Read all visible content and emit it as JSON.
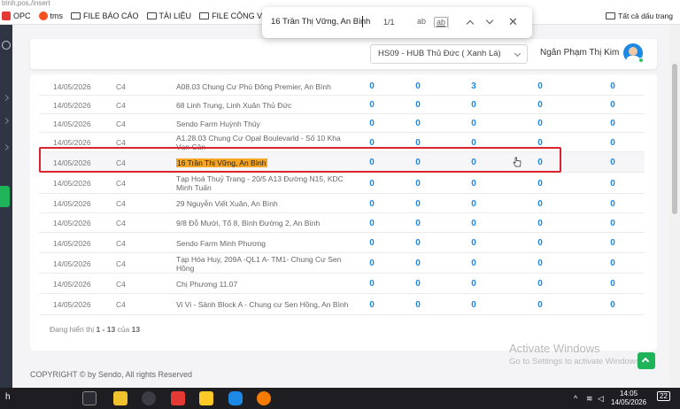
{
  "browser": {
    "address_text": "trinh,pos,/insert",
    "bookmarks": [
      {
        "label": "OPC",
        "icon": "opc-icon"
      },
      {
        "label": "tms",
        "icon": "tms-icon"
      },
      {
        "label": "FILE BÁO CÁO",
        "icon": "folder-icon"
      },
      {
        "label": "TÀI LIỆU",
        "icon": "folder-icon"
      },
      {
        "label": "FILE CÔNG VIỆC",
        "icon": "folder-icon"
      }
    ],
    "all_bookmarks_label": "Tất cả dấu trang"
  },
  "find_bar": {
    "query": "16 Trần Thị Vững, An Bình",
    "count": "1/1",
    "opt_case": "ab",
    "opt_word": "ab"
  },
  "header": {
    "hub_selected": "HS09 - HUB Thủ Đức ( Xanh Lá)",
    "user_name": "Ngân Phạm Thị Kim"
  },
  "table": {
    "rows": [
      {
        "date": "14/05/2026",
        "type": "C4",
        "address": "A08.03 Chung Cư Phú Đông Premier, An Bình",
        "v1": "0",
        "v2": "0",
        "v3": "3",
        "v4": "0",
        "v5": "0"
      },
      {
        "date": "14/05/2026",
        "type": "C4",
        "address": "68 Linh Trung, Linh Xuân Thủ Đức",
        "v1": "0",
        "v2": "0",
        "v3": "0",
        "v4": "0",
        "v5": "0"
      },
      {
        "date": "14/05/2026",
        "type": "C4",
        "address": "Sendo Farm Huỳnh Thúy",
        "v1": "0",
        "v2": "0",
        "v3": "0",
        "v4": "0",
        "v5": "0"
      },
      {
        "date": "14/05/2026",
        "type": "C4",
        "address": "A1.28.03 Chung Cư Opal Boulevarld - Số 10 Kha Vạn Cân",
        "v1": "0",
        "v2": "0",
        "v3": "0",
        "v4": "0",
        "v5": "0"
      },
      {
        "date": "14/05/2026",
        "type": "C4",
        "address": "16 Trần Thị Vững, An Bình",
        "v1": "0",
        "v2": "0",
        "v3": "0",
        "v4": "0",
        "v5": "0"
      },
      {
        "date": "14/05/2026",
        "type": "C4",
        "address": "Tạp Hoá Thuỷ Trang - 20/5 A13 Đường N15, KDC Minh Tuấn",
        "v1": "0",
        "v2": "0",
        "v3": "0",
        "v4": "0",
        "v5": "0"
      },
      {
        "date": "14/05/2026",
        "type": "C4",
        "address": "29 Nguyễn Viết Xuân, An Bình",
        "v1": "0",
        "v2": "0",
        "v3": "0",
        "v4": "0",
        "v5": "0"
      },
      {
        "date": "14/05/2026",
        "type": "C4",
        "address": "9/8 Đỗ Mười, Tổ 8, Bình Đường 2, An Bình",
        "v1": "0",
        "v2": "0",
        "v3": "0",
        "v4": "0",
        "v5": "0"
      },
      {
        "date": "14/05/2026",
        "type": "C4",
        "address": "Sendo Farm Minh Phương",
        "v1": "0",
        "v2": "0",
        "v3": "0",
        "v4": "0",
        "v5": "0"
      },
      {
        "date": "14/05/2026",
        "type": "C4",
        "address": "Tạp Hóa Huy, 209A -QL1 A- TM1- Chung Cư Sen Hồng",
        "v1": "0",
        "v2": "0",
        "v3": "0",
        "v4": "0",
        "v5": "0"
      },
      {
        "date": "14/05/2026",
        "type": "C4",
        "address": "Chị Phương 11.07",
        "v1": "0",
        "v2": "0",
        "v3": "0",
        "v4": "0",
        "v5": "0"
      },
      {
        "date": "14/05/2026",
        "type": "C4",
        "address": "Vi Vi - Sảnh Block A - Chung cư Sen Hồng, An Bình",
        "v1": "0",
        "v2": "0",
        "v3": "0",
        "v4": "0",
        "v5": "0"
      }
    ],
    "footer_prefix": "Đang hiển thị ",
    "footer_range": "1 - 13",
    "footer_mid": " của ",
    "footer_total": "13"
  },
  "copyright": "COPYRIGHT © by Sendo, All rights Reserved",
  "watermark": {
    "line1": "Activate Windows",
    "line2": "Go to Settings to activate Windows."
  },
  "taskbar": {
    "search_text": "h",
    "time": "14:05",
    "date": "14/05/2026",
    "notification_count": "22"
  },
  "colors": {
    "accent_blue": "#1e88e5",
    "highlight_box": "#d9232d",
    "find_match": "#f6a623",
    "brand_green": "#1fb45a"
  }
}
